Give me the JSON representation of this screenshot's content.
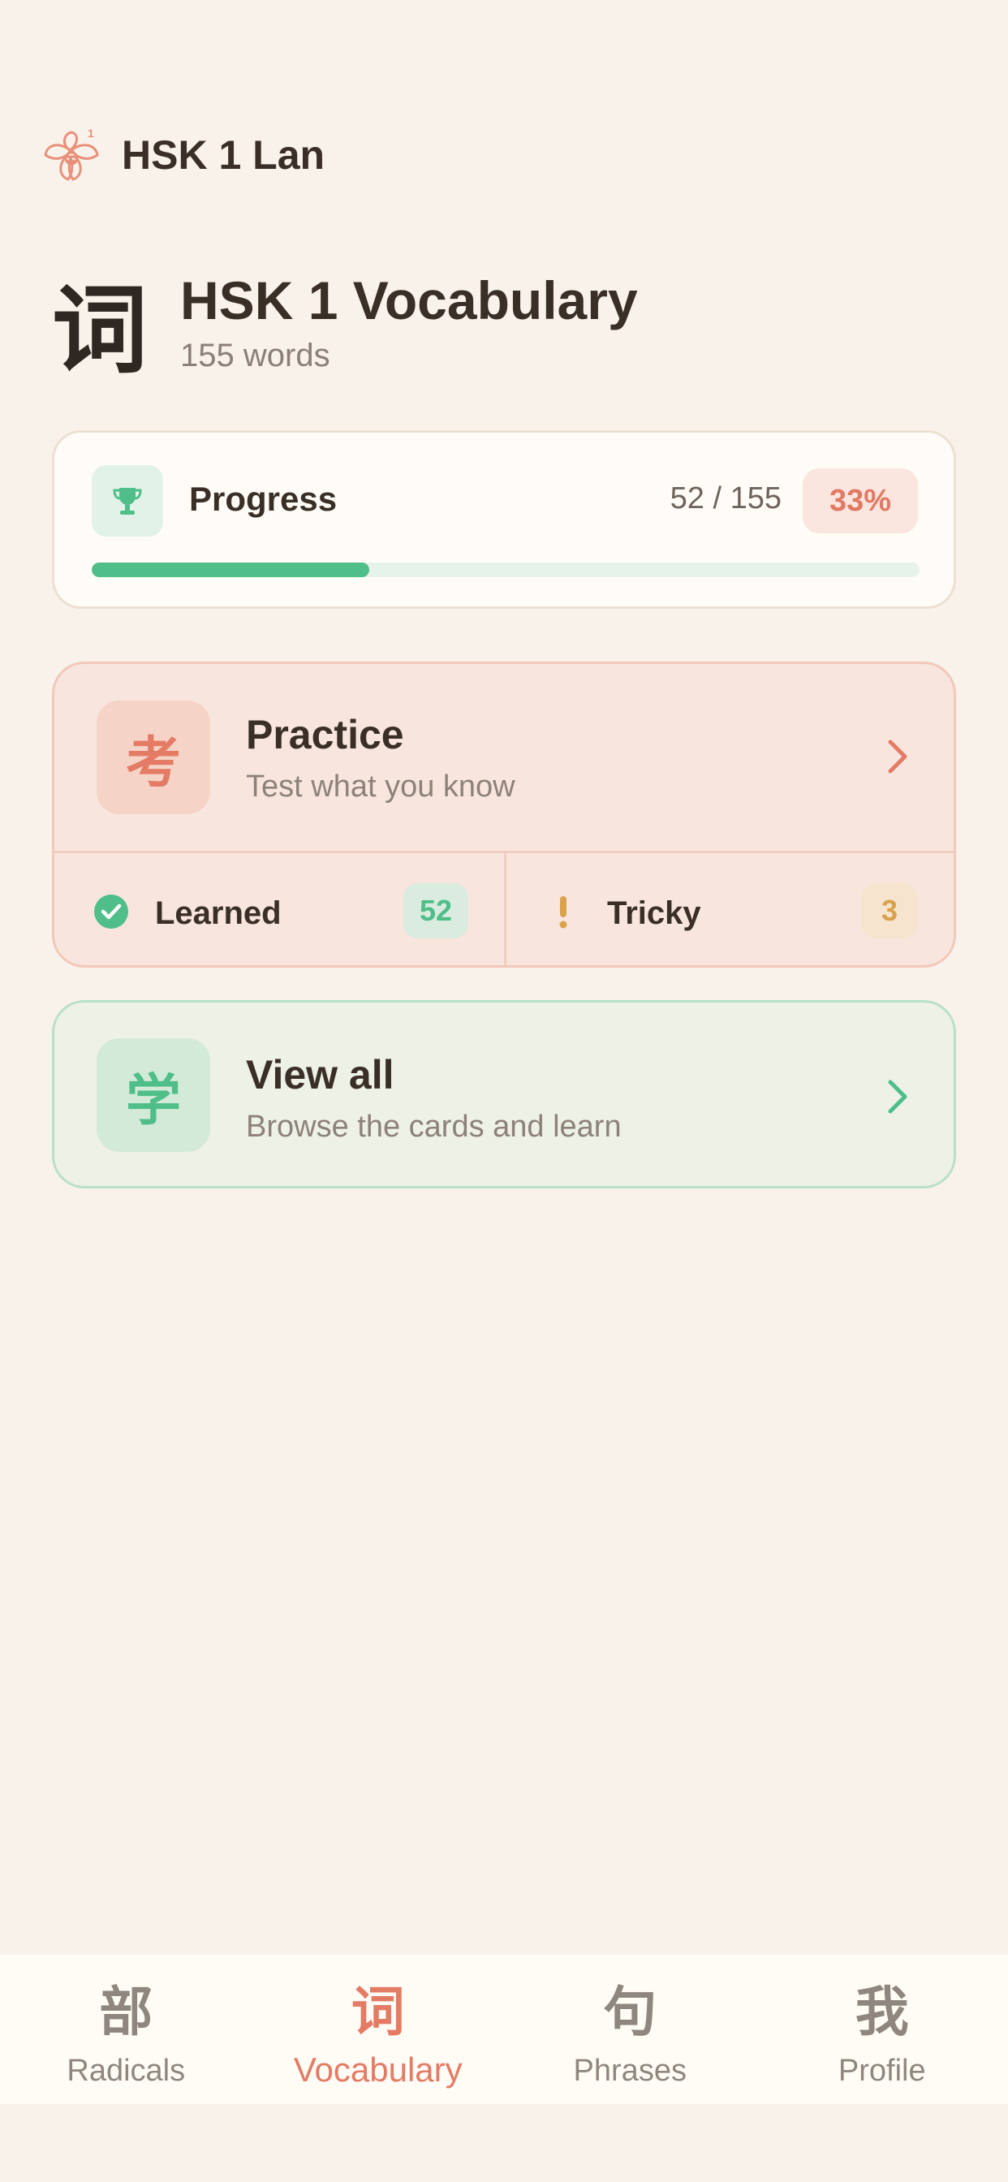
{
  "app": {
    "title": "HSK 1 Lan",
    "logo_icon": "orchid-logo-icon"
  },
  "section": {
    "glyph": "词",
    "title": "HSK 1 Vocabulary",
    "subtitle": "155 words"
  },
  "progress": {
    "label": "Progress",
    "count": "52 / 155",
    "percent_text": "33%",
    "fraction": 0.335,
    "icon": "trophy-icon"
  },
  "practice": {
    "icon_glyph": "考",
    "title": "Practice",
    "subtitle": "Test what you know",
    "stats": [
      {
        "label": "Learned",
        "count": "52",
        "icon": "check-circle-icon"
      },
      {
        "label": "Tricky",
        "count": "3",
        "icon": "exclamation-icon"
      }
    ]
  },
  "view_all": {
    "icon_glyph": "学",
    "title": "View all",
    "subtitle": "Browse the cards and learn"
  },
  "nav": {
    "items": [
      {
        "glyph": "部",
        "label": "Radicals",
        "active": false
      },
      {
        "glyph": "词",
        "label": "Vocabulary",
        "active": true
      },
      {
        "glyph": "句",
        "label": "Phrases",
        "active": false
      },
      {
        "glyph": "我",
        "label": "Profile",
        "active": false
      }
    ]
  },
  "colors": {
    "background": "#f9f2eb",
    "accent_coral": "#e47b64",
    "accent_green": "#4fbe88",
    "accent_amber": "#d9a24c",
    "text_dark": "#3a2f26"
  }
}
